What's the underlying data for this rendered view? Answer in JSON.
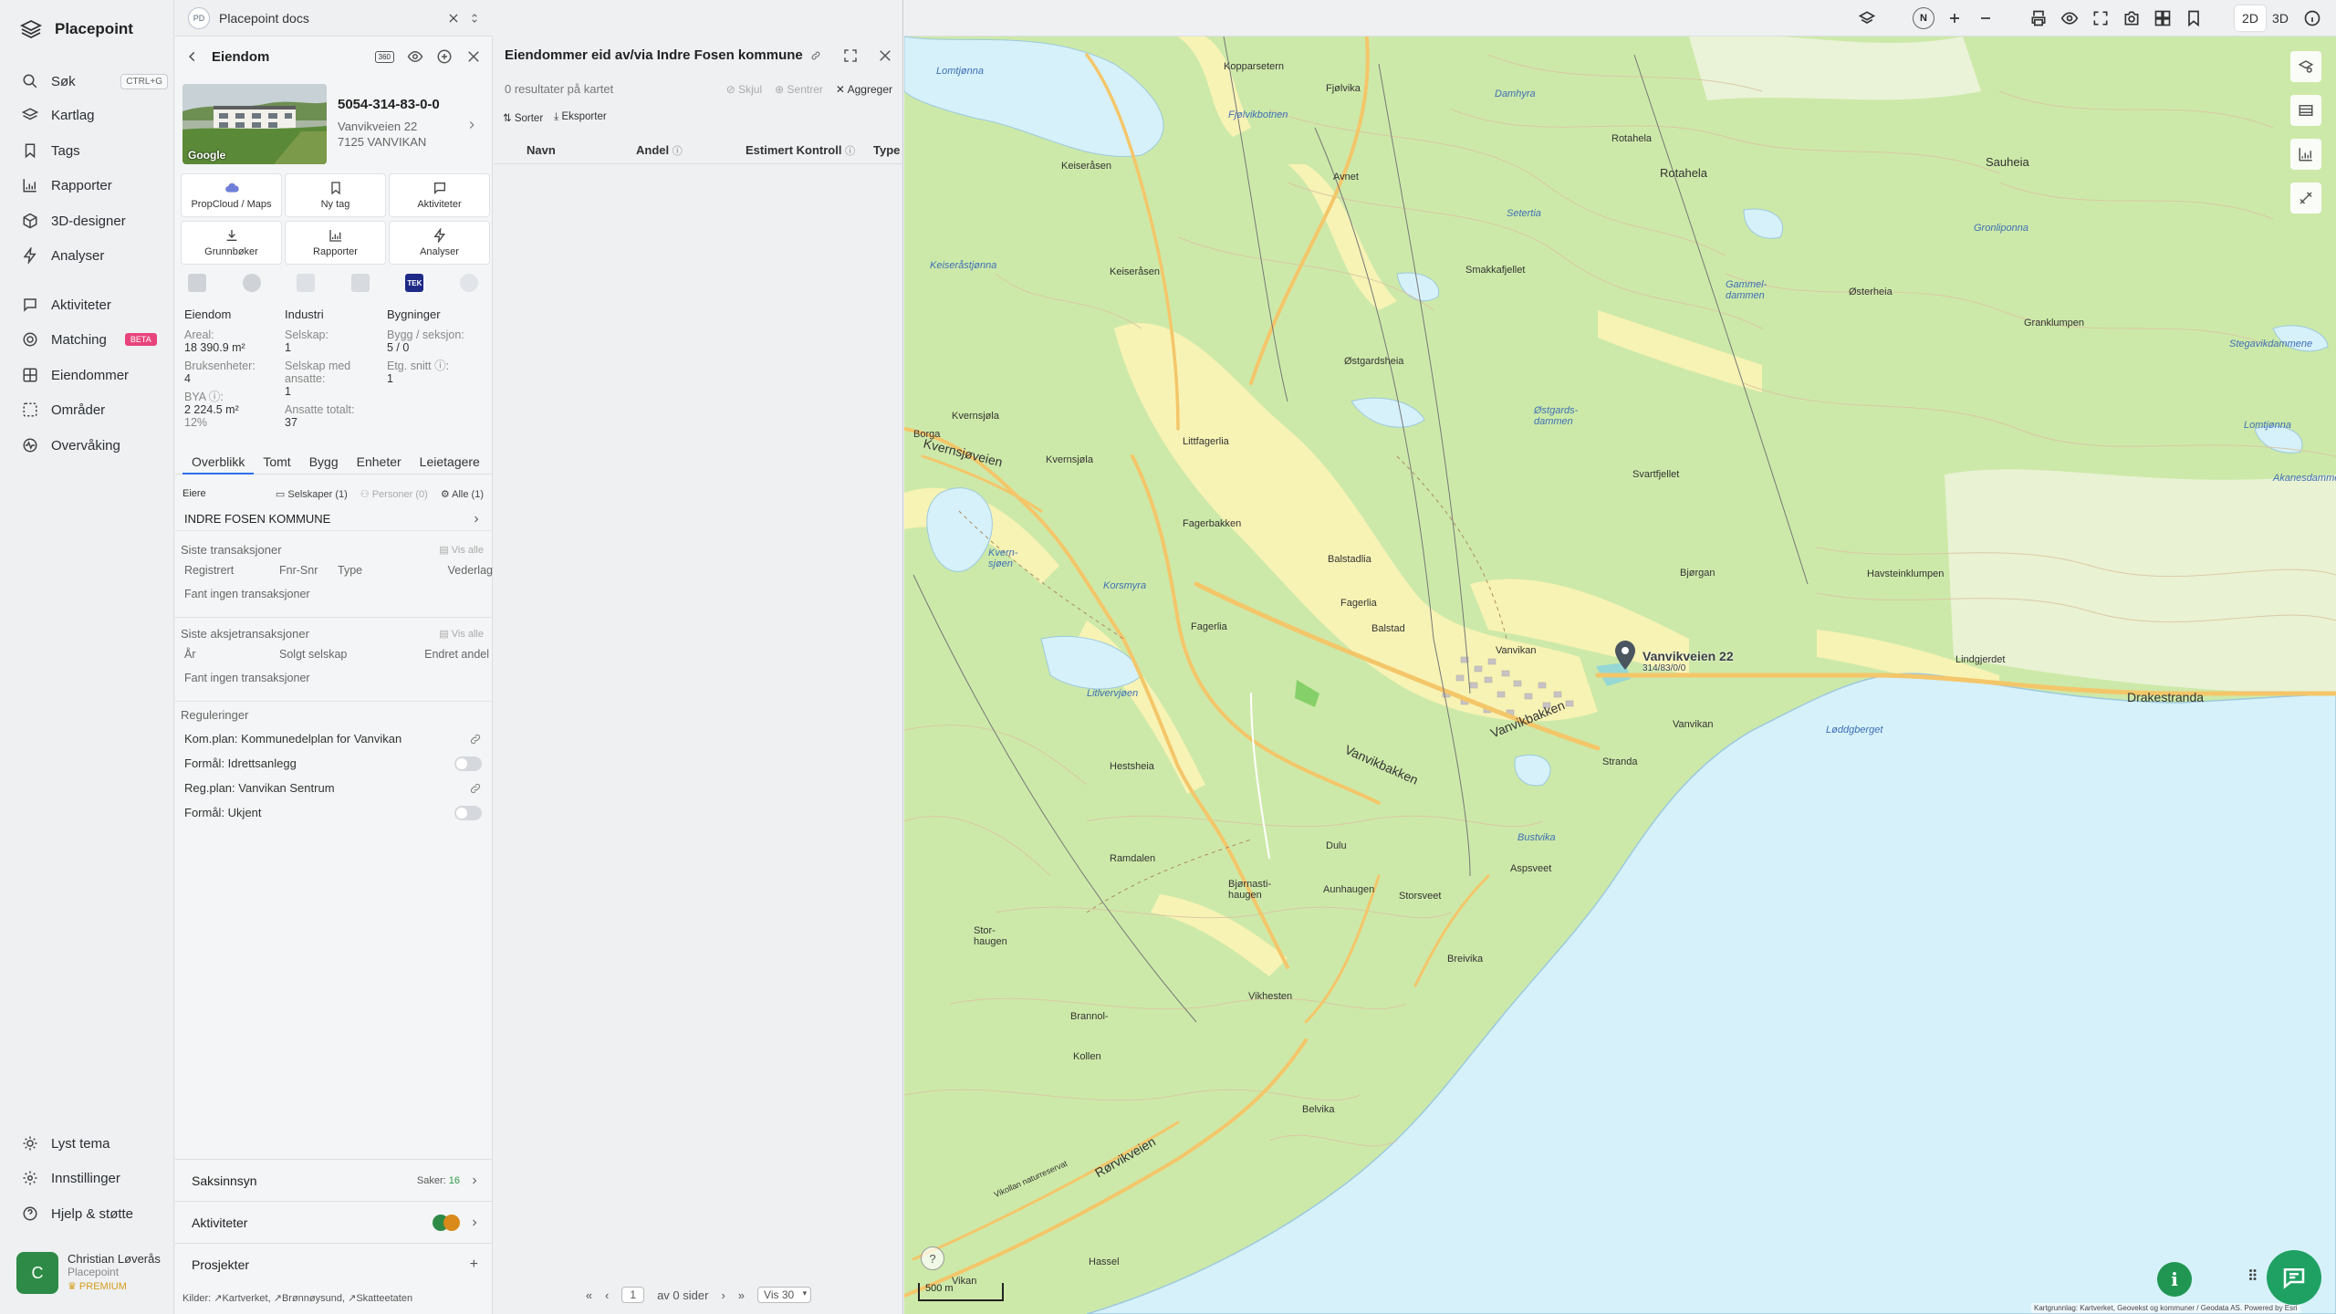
{
  "app": {
    "name": "Placepoint",
    "logo_icon": "layers-icon"
  },
  "nav": {
    "items": [
      {
        "label": "Søk",
        "icon": "search-icon",
        "shortcut": "CTRL+G"
      },
      {
        "label": "Kartlag",
        "icon": "layers-icon"
      },
      {
        "label": "Tags",
        "icon": "bookmark-icon"
      },
      {
        "label": "Rapporter",
        "icon": "chart-icon"
      },
      {
        "label": "3D-designer",
        "icon": "cube-icon"
      },
      {
        "label": "Analyser",
        "icon": "bolt-icon"
      },
      {
        "label": "Aktiviteter",
        "icon": "chat-icon"
      },
      {
        "label": "Matching",
        "icon": "target-icon",
        "badge": "BETA"
      },
      {
        "label": "Eiendommer",
        "icon": "grid-icon"
      },
      {
        "label": "Områder",
        "icon": "area-icon"
      },
      {
        "label": "Overvåking",
        "icon": "pulse-icon"
      }
    ],
    "bottom": [
      {
        "label": "Lyst tema",
        "icon": "sun-icon"
      },
      {
        "label": "Innstillinger",
        "icon": "gear-icon"
      },
      {
        "label": "Hjelp & støtte",
        "icon": "help-icon"
      }
    ],
    "user": {
      "initial": "C",
      "name": "Christian Løverås",
      "org": "Placepoint",
      "tier": "PREMIUM"
    }
  },
  "doc_tab": {
    "badge": "PD",
    "title": "Placepoint docs"
  },
  "property": {
    "header_title": "Eiendom",
    "badge_360": "360",
    "id": "5054-314-83-0-0",
    "street": "Vanvikveien 22",
    "postal": "7125 VANVIKAN",
    "photo_label": "Google",
    "actions": [
      {
        "label": "PropCloud / Maps",
        "icon": "cloud-icon"
      },
      {
        "label": "Ny tag",
        "icon": "bookmark-icon"
      },
      {
        "label": "Aktiviteter",
        "icon": "chat-icon"
      },
      {
        "label": "Grunnbøker",
        "icon": "download-icon"
      },
      {
        "label": "Rapporter",
        "icon": "chart-icon"
      },
      {
        "label": "Analyser",
        "icon": "bolt-icon"
      }
    ],
    "tek_label": "TEK",
    "stats": {
      "col1": {
        "header": "Eiendom",
        "areal_label": "Areal:",
        "areal": "18 390.9 m²",
        "bruks_label": "Bruksenheter:",
        "bruks": "4",
        "bya_label": "BYA ⓘ:",
        "bya": "2 224.5 m²",
        "bya_pct": "12%"
      },
      "col2": {
        "header": "Industri",
        "selskap_label": "Selskap:",
        "selskap": "1",
        "ansatte_label": "Selskap med ansatte:",
        "ansatte": "1",
        "ansatte_tot_label": "Ansatte totalt:",
        "ansatte_tot": "37"
      },
      "col3": {
        "header": "Bygninger",
        "bygg_label": "Bygg / seksjon:",
        "bygg": "5 / 0",
        "etg_label": "Etg. snitt ⓘ:",
        "etg": "1"
      }
    },
    "tabs": [
      "Overblikk",
      "Tomt",
      "Bygg",
      "Enheter",
      "Leietagere"
    ],
    "active_tab": "Overblikk",
    "owners": {
      "label": "Eiere",
      "filter_companies": "Selskaper (1)",
      "filter_persons": "Personer (0)",
      "filter_all": "Alle (1)",
      "owner_name": "INDRE FOSEN KOMMUNE"
    },
    "transactions": {
      "title": "Siste transaksjoner",
      "view_all": "Vis alle",
      "columns": [
        "Registrert",
        "Fnr-Snr",
        "Type",
        "Vederlag"
      ],
      "empty": "Fant ingen transaksjoner"
    },
    "share_transactions": {
      "title": "Siste aksjetransaksjoner",
      "view_all": "Vis alle",
      "columns": [
        "År",
        "Solgt selskap",
        "Endret andel"
      ],
      "empty": "Fant ingen transaksjoner"
    },
    "regulations": {
      "title": "Reguleringer",
      "items": [
        {
          "label": "Kom.plan: Kommunedelplan for Vanvikan",
          "kind": "link"
        },
        {
          "label": "Formål: Idrettsanlegg",
          "kind": "toggle"
        },
        {
          "label": "Reg.plan: Vanvikan Sentrum",
          "kind": "link"
        },
        {
          "label": "Formål: Ukjent",
          "kind": "toggle"
        }
      ]
    },
    "bottom_rows": {
      "saksinnsyn": "Saksinnsyn",
      "saker_label": "Saker:",
      "saker_count": "16",
      "aktiviteter": "Aktiviteter",
      "prosjekter": "Prosjekter",
      "plus": "+"
    },
    "sources": {
      "label": "Kilder:",
      "items": [
        "Kartverket,",
        "Brønnøysund,",
        "Skatteetaten"
      ]
    }
  },
  "results": {
    "title": "Eiendommer eid av/via Indre Fosen kommune",
    "count_text": "0 resultater på kartet",
    "hide": "Skjul",
    "center": "Sentrer",
    "aggregate": "Aggreger",
    "sort": "Sorter",
    "export": "Eksporter",
    "columns": [
      {
        "label": "Navn",
        "info": false
      },
      {
        "label": "Andel",
        "info": true
      },
      {
        "label": "Estimert Kontroll",
        "info": true
      },
      {
        "label": "Type",
        "info": false
      }
    ],
    "pager": {
      "page": "1",
      "of_pages": "av 0 sider",
      "per_page": "Vis 30"
    }
  },
  "map": {
    "toolbar_compass": "N",
    "modes": [
      "2D",
      "3D"
    ],
    "active_mode": "2D",
    "scale": "500 m",
    "attribution": "Kartgrunnlag: Kartverket, Geovekst og kommuner / Geodata AS. Powered by Esri",
    "pin_label_line1": "Vanvikveien 22",
    "pin_label_line2": "314/83/0/0",
    "colors": {
      "sea": "#d6f1fa",
      "forest": "#cde9a9",
      "field": "#f7f3b4",
      "road": "#f4c66a",
      "contour": "#d9c5a3"
    },
    "place_labels": [
      {
        "text": "Lomtjønna",
        "kind": "water"
      },
      {
        "text": "Kopparsetern",
        "kind": "place"
      },
      {
        "text": "Fjølvika",
        "kind": "place"
      },
      {
        "text": "Damhyra",
        "kind": "water"
      },
      {
        "text": "Fjølvikbotnen",
        "kind": "water"
      },
      {
        "text": "Rotahela",
        "kind": "place"
      },
      {
        "text": "Sauheia",
        "kind": "place"
      },
      {
        "text": "Rotahela",
        "kind": "place_bold"
      },
      {
        "text": "Keiseråsen",
        "kind": "place"
      },
      {
        "text": "Avnet",
        "kind": "place"
      },
      {
        "text": "Setertia",
        "kind": "water"
      },
      {
        "text": "Gronliponna",
        "kind": "water"
      },
      {
        "text": "Keiseråstjønna",
        "kind": "water"
      },
      {
        "text": "Keiseråsen",
        "kind": "place"
      },
      {
        "text": "Smakkafjellet",
        "kind": "place"
      },
      {
        "text": "Gammel-dammen",
        "kind": "water"
      },
      {
        "text": "Østerheia",
        "kind": "place"
      },
      {
        "text": "Granklumpen",
        "kind": "place"
      },
      {
        "text": "Stegavikdammene",
        "kind": "water"
      },
      {
        "text": "Østgardsheia",
        "kind": "place"
      },
      {
        "text": "Østgards-dammen",
        "kind": "water"
      },
      {
        "text": "Kvernsjøla",
        "kind": "place"
      },
      {
        "text": "Kvernsjøveien",
        "kind": "road"
      },
      {
        "text": "Borga",
        "kind": "place"
      },
      {
        "text": "Littfagerlia",
        "kind": "place"
      },
      {
        "text": "Kvernsjøla",
        "kind": "place"
      },
      {
        "text": "Svartfjellet",
        "kind": "place"
      },
      {
        "text": "Lomtjønna",
        "kind": "water"
      },
      {
        "text": "Akanesdammen",
        "kind": "water"
      },
      {
        "text": "Fagerbakken",
        "kind": "place"
      },
      {
        "text": "Kvern-sjøen",
        "kind": "water"
      },
      {
        "text": "Korsmyra",
        "kind": "water"
      },
      {
        "text": "Balstadlia",
        "kind": "place"
      },
      {
        "text": "Bjørgan",
        "kind": "place"
      },
      {
        "text": "Havsteinklumpen",
        "kind": "place"
      },
      {
        "text": "Fagerlia",
        "kind": "place"
      },
      {
        "text": "Fagerlia",
        "kind": "place"
      },
      {
        "text": "Balstad",
        "kind": "place"
      },
      {
        "text": "Vanvikan",
        "kind": "place"
      },
      {
        "text": "Lindgjerdet",
        "kind": "place"
      },
      {
        "text": "Drakestranda",
        "kind": "road"
      },
      {
        "text": "Litlvervjøen",
        "kind": "water"
      },
      {
        "text": "Vanvikbakken",
        "kind": "road"
      },
      {
        "text": "Vanvikan",
        "kind": "place"
      },
      {
        "text": "Løddgberget",
        "kind": "place"
      },
      {
        "text": "Hestsheia",
        "kind": "place"
      },
      {
        "text": "Stranda",
        "kind": "place"
      },
      {
        "text": "Vanvikbakken",
        "kind": "road"
      },
      {
        "text": "Dulu",
        "kind": "place"
      },
      {
        "text": "Bustvika",
        "kind": "water"
      },
      {
        "text": "Aunhaugen",
        "kind": "place"
      },
      {
        "text": "Aspsveet",
        "kind": "place"
      },
      {
        "text": "Ramdalen",
        "kind": "place"
      },
      {
        "text": "Bjørnasti-haugen",
        "kind": "place"
      },
      {
        "text": "Storsveet",
        "kind": "place"
      },
      {
        "text": "Stor-haugen",
        "kind": "place"
      },
      {
        "text": "Breivika",
        "kind": "place"
      },
      {
        "text": "Vikhesten",
        "kind": "place"
      },
      {
        "text": "Brannol-",
        "kind": "place"
      },
      {
        "text": "Kollen",
        "kind": "place"
      },
      {
        "text": "Belvika",
        "kind": "place"
      },
      {
        "text": "Rørvikveien",
        "kind": "road"
      },
      {
        "text": "Vikollan naturreservat",
        "kind": "place"
      },
      {
        "text": "Hassel",
        "kind": "place"
      },
      {
        "text": "Vikan",
        "kind": "place"
      }
    ]
  }
}
